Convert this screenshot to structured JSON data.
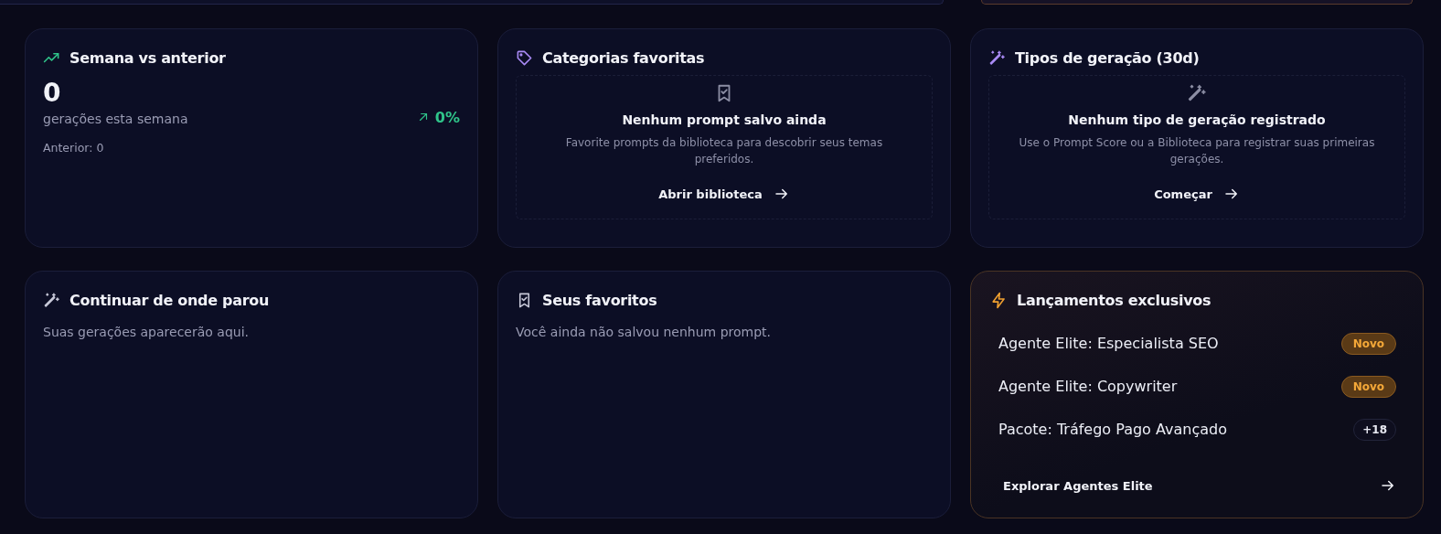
{
  "cards": [
    {
      "kind": "stat",
      "title": "Semana vs anterior",
      "value": "0",
      "caption": "gerações esta semana",
      "change": "0%",
      "previous": "Anterior: 0"
    },
    {
      "kind": "empty",
      "title": "Categorias favoritas",
      "heading": "Nenhum prompt salvo ainda",
      "text": "Favorite prompts da biblioteca para descobrir seus temas preferidos.",
      "action": "Abrir biblioteca"
    },
    {
      "kind": "empty",
      "title": "Tipos de geração (30d)",
      "heading": "Nenhum tipo de geração registrado",
      "text": "Use o Prompt Score ou a Biblioteca para registrar suas primeiras gerações.",
      "action": "Começar"
    },
    {
      "kind": "message",
      "title": "Continuar de onde parou",
      "text": "Suas gerações aparecerão aqui."
    },
    {
      "kind": "message",
      "title": "Seus favoritos",
      "text": "Você ainda não salvou nenhum prompt."
    },
    {
      "kind": "launches",
      "title": "Lançamentos exclusivos",
      "items": [
        {
          "name": "Agente Elite: Especialista SEO",
          "badge": "Novo",
          "kind": "new"
        },
        {
          "name": "Agente Elite: Copywriter",
          "badge": "Novo",
          "kind": "new"
        },
        {
          "name": "Pacote: Tráfego Pago Avançado",
          "badge": "+18",
          "kind": "count"
        }
      ],
      "action": "Explorar Agentes Elite"
    }
  ]
}
